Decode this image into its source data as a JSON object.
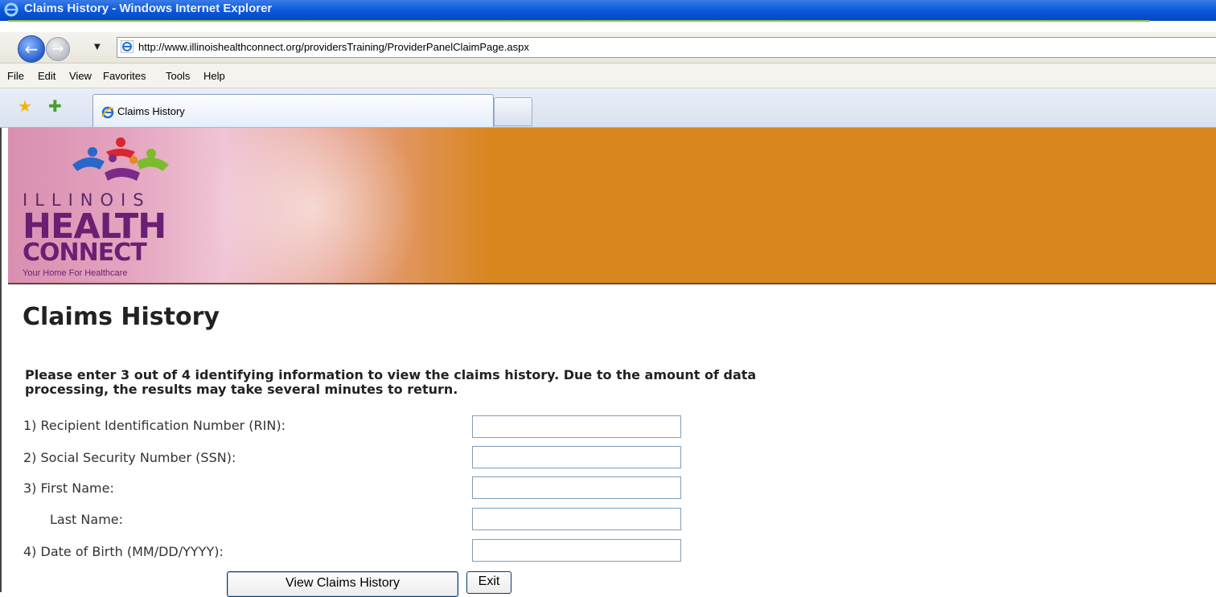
{
  "window": {
    "title": "Claims History - Windows Internet Explorer"
  },
  "navigation": {
    "back_icon": "back-arrow-icon",
    "forward_icon": "forward-arrow-icon",
    "address_url": "http://www.illinoishealthconnect.org/providersTraining/ProviderPanelClaimPage.aspx"
  },
  "menu": {
    "items": [
      "File",
      "Edit",
      "View",
      "Favorites",
      "Tools",
      "Help"
    ]
  },
  "tabs": {
    "active_label": "Claims History"
  },
  "logo": {
    "line1": "ILLINOIS",
    "line2": "HEALTH",
    "line3": "CONNECT",
    "tagline": "Your Home For Healthcare"
  },
  "page": {
    "title": "Claims History",
    "instructions": "Please enter 3 out of 4 identifying information to view the claims history. Due to the amount of data processing, the results may take several minutes to return."
  },
  "form": {
    "fields": [
      {
        "label": "1) Recipient Identification Number (RIN):",
        "value": ""
      },
      {
        "label": "2) Social Security Number (SSN):",
        "value": ""
      },
      {
        "label": "3) First Name:",
        "value": ""
      },
      {
        "label": "Last Name:",
        "value": ""
      },
      {
        "label": "4) Date of Birth (MM/DD/YYYY):",
        "value": ""
      }
    ],
    "submit_label": "View Claims History",
    "exit_label": "Exit"
  },
  "colors": {
    "banner_orange": "#d8861e",
    "logo_purple": "#6a1f73",
    "titlebar_blue": "#0a58dc"
  }
}
